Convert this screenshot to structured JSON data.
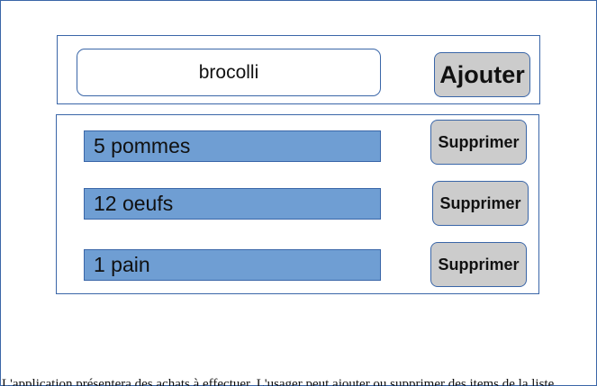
{
  "add_form": {
    "input_value": "brocolli",
    "add_label": "Ajouter"
  },
  "items": [
    {
      "label": "5 pommes",
      "delete_label": "Supprimer"
    },
    {
      "label": "12 oeufs",
      "delete_label": "Supprimer"
    },
    {
      "label": "1 pain",
      "delete_label": "Supprimer"
    }
  ],
  "footer": {
    "text": "L'application présentera des achats à effectuer. L'usager peut ajouter ou supprimer des items de la liste"
  },
  "colors": {
    "border": "#3a66a8",
    "item_fill": "#6f9ed3",
    "button_fill": "#cccccc"
  }
}
